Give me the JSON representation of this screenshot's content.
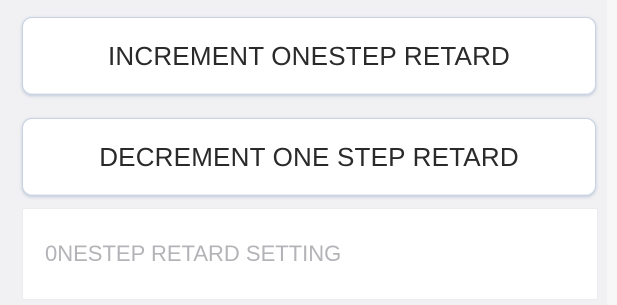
{
  "buttons": {
    "increment_label": "INCREMENT ONESTEP RETARD",
    "decrement_label": "DECREMENT ONE STEP RETARD"
  },
  "setting": {
    "value": "",
    "placeholder": "0NESTEP RETARD SETTING"
  },
  "colors": {
    "background": "#f1f1f3",
    "button_border": "#c9d3e4",
    "text": "#2a2a2a",
    "placeholder": "#b4b4b8"
  }
}
